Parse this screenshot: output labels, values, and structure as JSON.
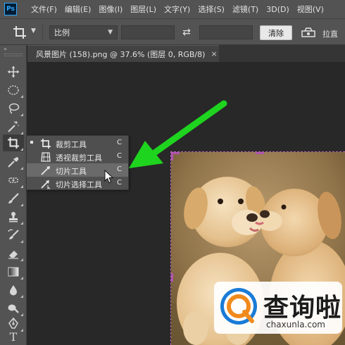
{
  "app": {
    "logo_text": "Ps"
  },
  "menubar": {
    "items": [
      "文件(F)",
      "编辑(E)",
      "图像(I)",
      "图层(L)",
      "文字(Y)",
      "选择(S)",
      "滤镜(T)",
      "3D(D)",
      "视图(V)"
    ]
  },
  "options": {
    "ratio_label": "比例",
    "swap_icon": "⇄",
    "clear_label": "清除",
    "straighten_label": "拉直"
  },
  "panel": {
    "collapse_label": "»"
  },
  "document": {
    "tab_title": "风景图片 (158).png @ 37.6% (图层 0, RGB/8)",
    "close_label": "×"
  },
  "tools": [
    {
      "name": "move-tool",
      "icon": "move-icon"
    },
    {
      "name": "marquee-tool",
      "icon": "ellipse-marquee-icon"
    },
    {
      "name": "lasso-tool",
      "icon": "lasso-icon"
    },
    {
      "name": "magic-wand-tool",
      "icon": "magic-wand-icon"
    },
    {
      "name": "crop-tool",
      "icon": "crop-icon",
      "active": true
    },
    {
      "name": "eyedropper-tool",
      "icon": "eyedropper-icon"
    },
    {
      "name": "healing-tool",
      "icon": "healing-brush-icon"
    },
    {
      "name": "brush-tool",
      "icon": "brush-icon"
    },
    {
      "name": "stamp-tool",
      "icon": "stamp-icon"
    },
    {
      "name": "history-brush-tool",
      "icon": "history-brush-icon"
    },
    {
      "name": "eraser-tool",
      "icon": "eraser-icon"
    },
    {
      "name": "gradient-tool",
      "icon": "gradient-icon"
    },
    {
      "name": "blur-tool",
      "icon": "blur-drop-icon"
    },
    {
      "name": "dodge-tool",
      "icon": "dodge-icon"
    },
    {
      "name": "pen-tool",
      "icon": "pen-icon"
    },
    {
      "name": "type-tool",
      "icon": "type-icon",
      "text": "T"
    }
  ],
  "flyout": {
    "items": [
      {
        "label": "裁剪工具",
        "key": "C",
        "icon": "crop-icon",
        "selected": true
      },
      {
        "label": "透视裁剪工具",
        "key": "C",
        "icon": "perspective-crop-icon"
      },
      {
        "label": "切片工具",
        "key": "C",
        "icon": "slice-icon",
        "hover": true
      },
      {
        "label": "切片选择工具",
        "key": "C",
        "icon": "slice-select-icon"
      }
    ]
  },
  "watermark": {
    "title": "查询啦",
    "url": "chaxunla.com"
  },
  "colors": {
    "chrome": "#535353",
    "canvas_bg": "#282828",
    "arrow_green": "#1ed41e",
    "crop_border": "#b255ad",
    "watermark_blue": "#1a7bd6"
  }
}
